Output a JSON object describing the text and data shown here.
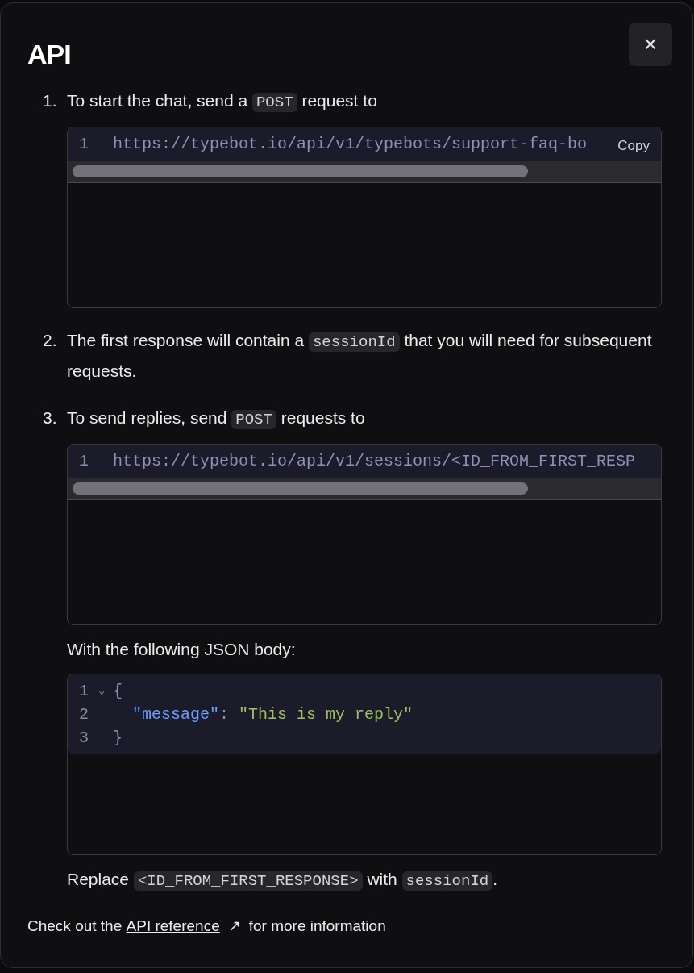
{
  "dialog": {
    "title": "API",
    "close": "×"
  },
  "steps": [
    {
      "number": "1.",
      "segments": [
        {
          "kind": "text",
          "text": "To start the chat, send a "
        },
        {
          "kind": "code",
          "text": "POST"
        },
        {
          "kind": "text",
          "text": " request to"
        }
      ],
      "blocks": [
        {
          "kind": "url",
          "lines": [
            {
              "number": "1",
              "tokens": [
                {
                  "kind": "plain",
                  "text": "https://typebot.io/api/v1/typebots/support-faq-bo"
                }
              ]
            }
          ],
          "copy": "Copy"
        }
      ]
    },
    {
      "number": "2.",
      "segments": [
        {
          "kind": "text",
          "text": "The first response will contain a "
        },
        {
          "kind": "code",
          "text": "sessionId"
        },
        {
          "kind": "text",
          "text": " that you will need for subsequent requests."
        }
      ]
    },
    {
      "number": "3.",
      "segments": [
        {
          "kind": "text",
          "text": "To send replies, send "
        },
        {
          "kind": "code",
          "text": "POST"
        },
        {
          "kind": "text",
          "text": " requests to"
        }
      ],
      "blocks": [
        {
          "kind": "url",
          "lines": [
            {
              "number": "1",
              "tokens": [
                {
                  "kind": "plain",
                  "text": "https://typebot.io/api/v1/sessions/<ID_FROM_FIRST_RESP"
                }
              ]
            }
          ]
        },
        {
          "kind": "caption",
          "segments": [
            {
              "kind": "text",
              "text": "With the following JSON body:"
            }
          ]
        },
        {
          "kind": "json",
          "lines": [
            {
              "number": "1",
              "fold": "⌄",
              "tokens": [
                {
                  "kind": "punct",
                  "text": "{"
                }
              ]
            },
            {
              "number": "2",
              "tokens": [
                {
                  "kind": "key",
                  "text": "\"message\""
                },
                {
                  "kind": "punct",
                  "text": ": "
                },
                {
                  "kind": "string",
                  "text": "\"This is my reply\""
                }
              ]
            },
            {
              "number": "3",
              "tokens": [
                {
                  "kind": "punct",
                  "text": "}"
                }
              ]
            }
          ]
        },
        {
          "kind": "caption",
          "segments": [
            {
              "kind": "text",
              "text": "Replace "
            },
            {
              "kind": "code",
              "text": "<ID_FROM_FIRST_RESPONSE>"
            },
            {
              "kind": "text",
              "text": " with "
            },
            {
              "kind": "code",
              "text": "sessionId"
            },
            {
              "kind": "text",
              "text": "."
            }
          ]
        }
      ]
    }
  ],
  "footer": {
    "before": "Check out the ",
    "link": "API reference",
    "arrow": "↗",
    "after": " for more information"
  }
}
